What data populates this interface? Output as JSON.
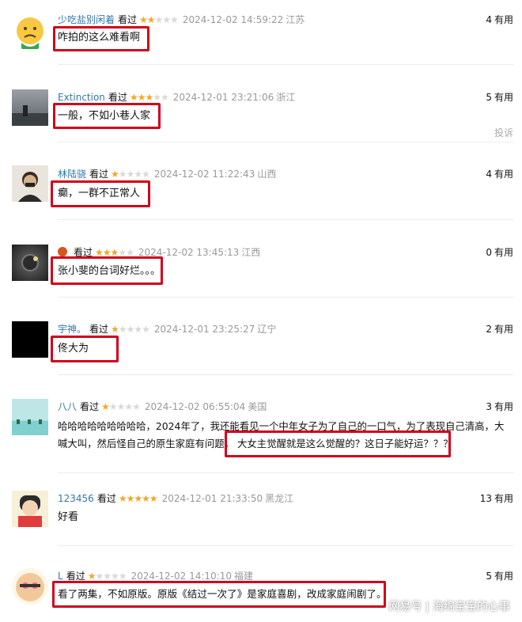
{
  "comments": [
    {
      "user": "少吃盐别闲着",
      "watched": "看过",
      "rating": 2,
      "time": "2024-12-02 14:59:22",
      "location": "江苏",
      "useful_count": "4",
      "useful_label": "有用",
      "content": "咋拍的这么难看啊"
    },
    {
      "user": "Extinction",
      "watched": "看过",
      "rating": 3,
      "time": "2024-12-01 23:21:06",
      "location": "浙江",
      "useful_count": "5",
      "useful_label": "有用",
      "content": "一般，不如小巷人家",
      "report": "投诉"
    },
    {
      "user": "林陆骁",
      "watched": "看过",
      "rating": 1,
      "time": "2024-12-02 11:22:43",
      "location": "山西",
      "useful_count": "4",
      "useful_label": "有用",
      "content": "癫，一群不正常人"
    },
    {
      "user": "",
      "watched": "看过",
      "rating": 3,
      "time": "2024-12-02 13:45:13",
      "location": "江西",
      "useful_count": "0",
      "useful_label": "有用",
      "content": "张小斐的台词好烂。。。"
    },
    {
      "user": "宇神。",
      "watched": "看过",
      "rating": 1,
      "time": "2024-12-01 23:25:27",
      "location": "辽宁",
      "useful_count": "2",
      "useful_label": "有用",
      "content": "佟大为"
    },
    {
      "user": "八八",
      "watched": "看过",
      "rating": 1,
      "time": "2024-12-02 06:55:04",
      "location": "美国",
      "useful_count": "3",
      "useful_label": "有用",
      "content_line1": "哈哈哈哈哈哈哈哈哈，2024年了，我还能看见一个中年女子为了自己的一口气，为了表现自己清高，大",
      "content_line2a": "喊大叫，然后怪自己的原生家庭有问题，",
      "content_line2b": "大女主觉醒就是这么觉醒的？这日子能好运？？？"
    },
    {
      "user": "123456",
      "watched": "看过",
      "rating": 5,
      "time": "2024-12-01 21:33:50",
      "location": "黑龙江",
      "useful_count": "13",
      "useful_label": "有用",
      "content": "好看"
    },
    {
      "user": "L",
      "watched": "看过",
      "rating": 1,
      "time": "2024-12-02 14:10:10",
      "location": "福建",
      "useful_count": "5",
      "useful_label": "有用",
      "content": "看了两集，不如原版。原版《结过一次了》是家庭喜剧，改成家庭闹剧了。"
    }
  ],
  "watermark": "网易号 | 海绵宝宝的心事",
  "colors": {
    "highlight_box": "#d0021b",
    "username": "#3377aa",
    "star_on": "#f5a623",
    "star_off": "#d9d9d9"
  }
}
